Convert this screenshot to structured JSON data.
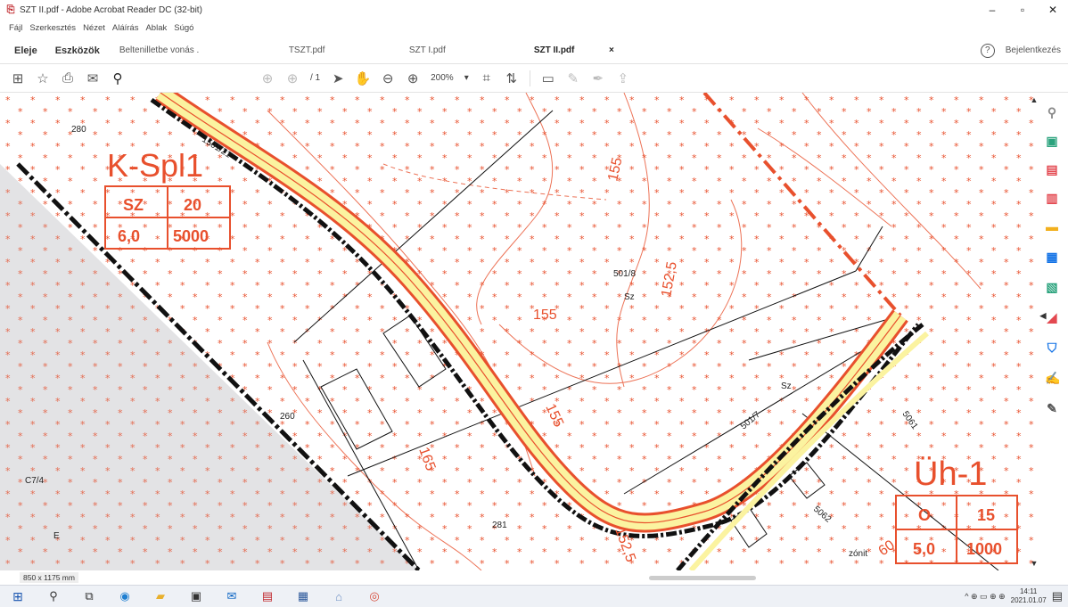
{
  "window": {
    "title": "SZT II.pdf - Adobe Acrobat Reader DC (32-bit)",
    "minimize": "–",
    "restore": "▫",
    "close": "✕"
  },
  "menu": [
    "Fájl",
    "Szerkesztés",
    "Nézet",
    "Aláírás",
    "Ablak",
    "Súgó"
  ],
  "tabs": {
    "home": "Eleje",
    "tools": "Eszközök",
    "doc1": "Beltenilletbe vonás .",
    "doc2": "TSZT.pdf",
    "doc3": "SZT I.pdf",
    "doc4": "SZT II.pdf",
    "doc4_close": "×",
    "help": "?",
    "sign_in": "Bejelentkezés"
  },
  "toolbar": {
    "page_text": "/ 1",
    "zoom": "200%"
  },
  "map": {
    "zone_left": {
      "name": "K-Spl1",
      "cells": [
        "SZ",
        "20",
        "6,0",
        "5000"
      ]
    },
    "zone_right": {
      "name": "Üh-1",
      "cells": [
        "O",
        "15",
        "5,0",
        "1000"
      ]
    },
    "labels": {
      "parcel_a": "501/8",
      "parcel_a_use": "Sz",
      "parcel_b_use": "Sz",
      "road": "1501/21",
      "top_left": "280",
      "left_parcel": "260",
      "bottom_parcel": "281",
      "c7": "C7/4",
      "small_e": "E",
      "p_501": "501/7",
      "p_5061": "5061",
      "p_house": "5062",
      "zone_tiny": "zónit",
      "contour_155a": "155",
      "contour_155b": "155",
      "contour_1525": "152,5",
      "contour_165": "165",
      "contour_road_a": "155",
      "contour_road_b": "152,5",
      "contour_br": "60"
    }
  },
  "status": {
    "page_dims": "850 x 1175 mm"
  },
  "taskbar": {
    "time": "14:11",
    "date": "2021.01.07",
    "tray_text": "^ ⊕ ▭ ⊕ ⊕"
  },
  "colors": {
    "zone_red": "#e8502d",
    "road_yellow": "#fbf3a0",
    "gray_zone": "#d9d9dc",
    "acrobat_blue": "#1473e6"
  }
}
